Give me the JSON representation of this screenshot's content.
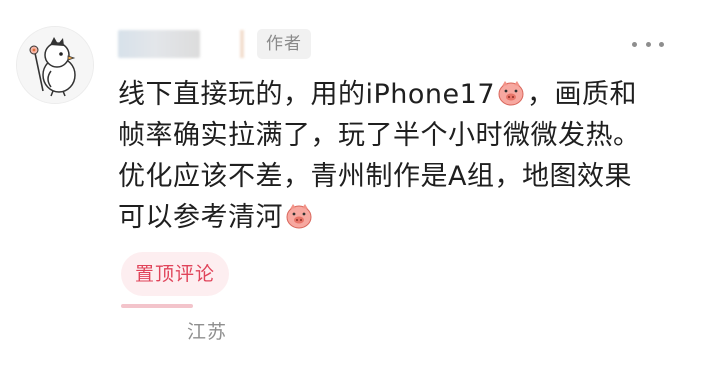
{
  "comment": {
    "author_badge": "作者",
    "lines": [
      {
        "before": "线下直接玩的，用的iPhone17",
        "emoji": "pig-face-emoji",
        "after": "，画质和"
      },
      {
        "text": "帧率确实拉满了，玩了半个小时微微发热。"
      },
      {
        "text": "优化应该不差，青州制作是A组，地图效果"
      },
      {
        "before": "可以参考清河",
        "emoji": "pig-face-emoji"
      }
    ],
    "pinned_label": "置顶评论",
    "location": "江苏"
  },
  "icons": {
    "avatar": "cartoon-bird-avatar",
    "more": "more-dots-icon",
    "emoji": "pig-face-emoji"
  },
  "colors": {
    "text": "#1f1f1f",
    "muted": "#8f8f8f",
    "badge_bg": "#f1f1f1",
    "pin_text": "#e0445a",
    "pin_bg": "#fdeef0"
  }
}
